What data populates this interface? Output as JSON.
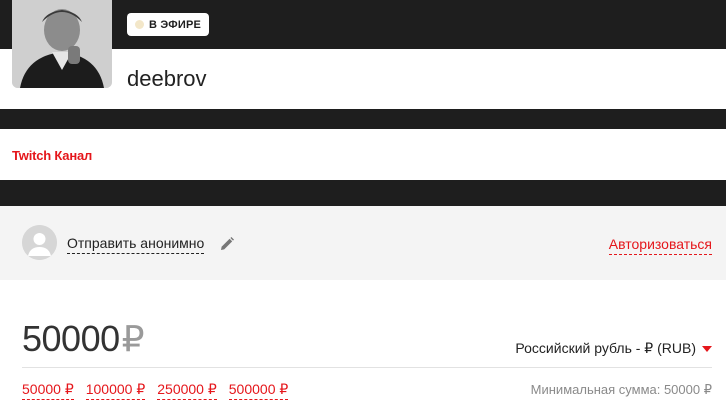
{
  "header": {
    "live_badge": "В ЭФИРЕ",
    "channel_name": "deebrov"
  },
  "links": {
    "twitch_channel": "Twitch Канал"
  },
  "sender": {
    "anonymous_label": "Отправить анонимно",
    "login_label": "Авторизоваться"
  },
  "amount": {
    "value": "50000",
    "currency_symbol": "₽",
    "currency_selected": "Российский рубль - ₽ (RUB)",
    "presets": [
      "50000 ₽",
      "100000 ₽",
      "250000 ₽",
      "500000 ₽"
    ],
    "minimum_text": "Минимальная сумма: 50000 ₽"
  },
  "colors": {
    "accent": "#e5161b",
    "dark_band": "#1e1e1e",
    "panel_bg": "#f4f4f4"
  },
  "icons": {
    "anon_avatar": "user-silhouette-icon",
    "edit": "pencil-icon",
    "dropdown": "caret-down-icon",
    "live": "live-dot-icon"
  }
}
